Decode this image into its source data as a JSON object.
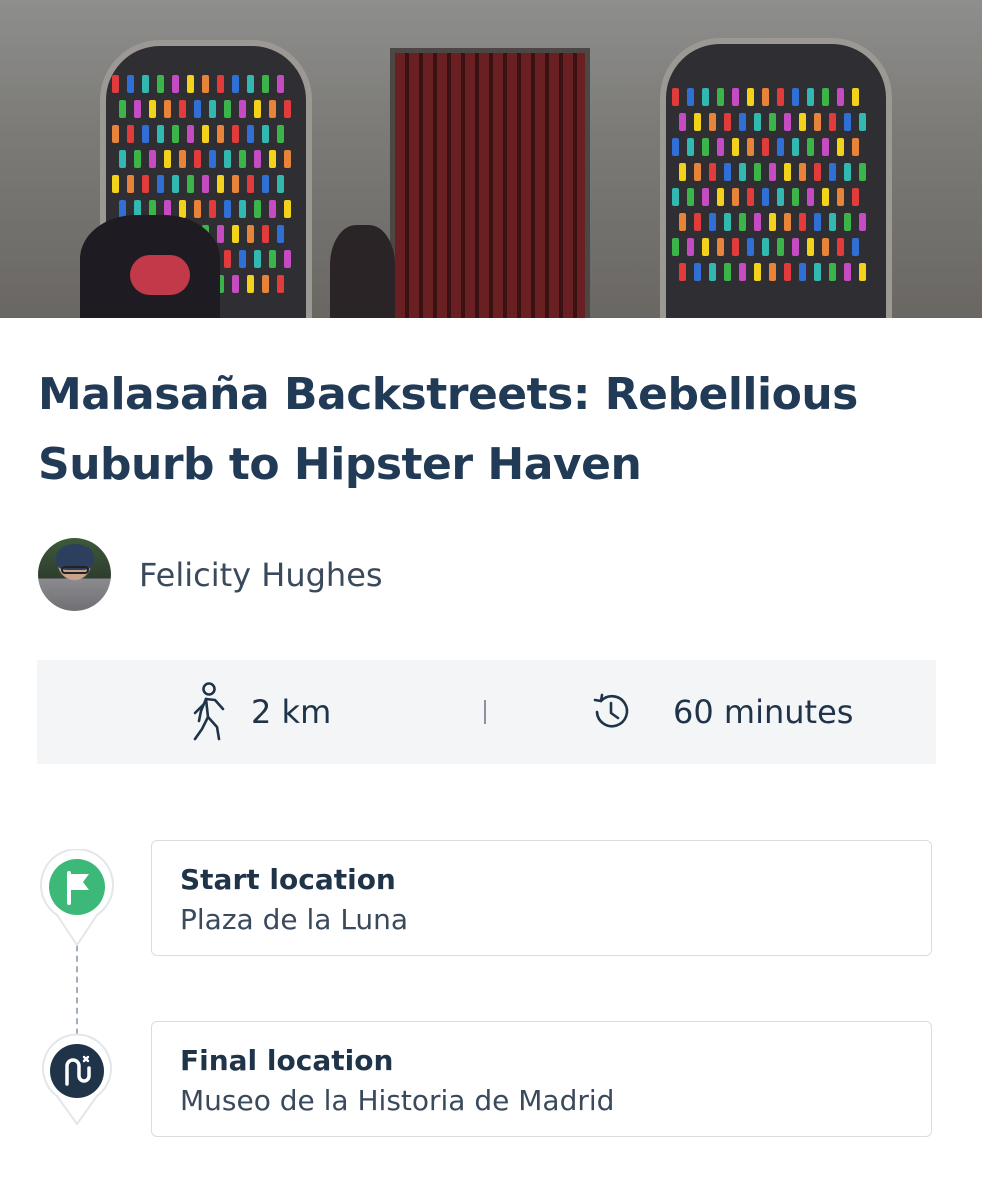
{
  "tour": {
    "title_line1": "Malasaña Backstreets: Rebellious",
    "title_line2": "Suburb to Hipster Haven",
    "hero_image_alt": "Graffiti-covered building facade with colorful bottles"
  },
  "author": {
    "name": "Felicity Hughes"
  },
  "stats": {
    "distance": "2 km",
    "duration": "60 minutes",
    "distance_icon": "walking-person-icon",
    "duration_icon": "history-clock-icon"
  },
  "route": {
    "start": {
      "label": "Start location",
      "value": "Plaza de la Luna",
      "icon": "flag-icon",
      "color": "#3cb878"
    },
    "final": {
      "label": "Final location",
      "value": "Museo de la Historia de Madrid",
      "icon": "route-end-icon",
      "color": "#1f3349"
    }
  }
}
